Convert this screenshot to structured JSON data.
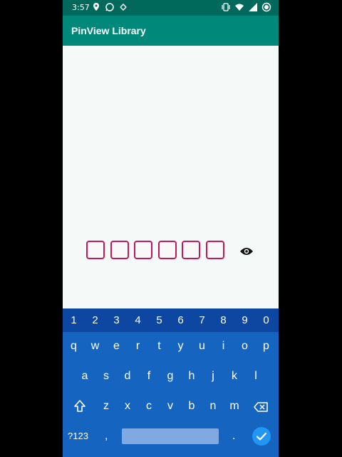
{
  "status_bar": {
    "time": "3:57",
    "left_icons": [
      "location-icon",
      "whatsapp-icon",
      "sync-icon"
    ],
    "right_icons": [
      "vibrate-icon",
      "wifi-icon",
      "signal-icon",
      "battery-icon"
    ]
  },
  "app_bar": {
    "title": "PinView Library"
  },
  "pin_view": {
    "boxes": 6,
    "toggle_icon": "eye-icon",
    "accent_color": "#c2185b"
  },
  "keyboard": {
    "number_row": [
      "1",
      "2",
      "3",
      "4",
      "5",
      "6",
      "7",
      "8",
      "9",
      "0"
    ],
    "row1": [
      "q",
      "w",
      "e",
      "r",
      "t",
      "y",
      "u",
      "i",
      "o",
      "p"
    ],
    "row2": [
      "a",
      "s",
      "d",
      "f",
      "g",
      "h",
      "j",
      "k",
      "l"
    ],
    "row3": [
      "z",
      "x",
      "c",
      "v",
      "b",
      "n",
      "m"
    ],
    "symbols_label": "?123",
    "comma_label": ",",
    "period_label": ".",
    "shift_icon": "shift-icon",
    "backspace_icon": "backspace-icon",
    "enter_icon": "check-icon",
    "bg_color": "#1565c0"
  }
}
